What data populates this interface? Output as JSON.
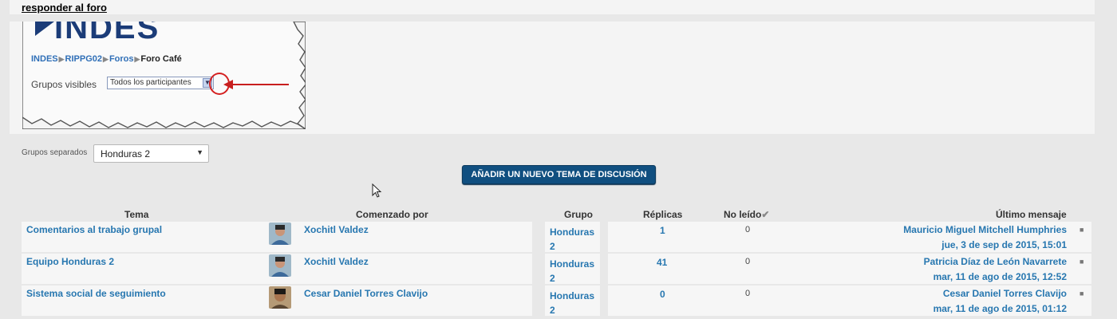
{
  "top": {
    "reply_link": "responder al foro"
  },
  "inset": {
    "logo": "INDES",
    "breadcrumb": [
      "INDES",
      "RIPPG02",
      "Foros",
      "Foro Café"
    ],
    "groups_visible_label": "Grupos visibles",
    "groups_visible_value": "Todos los participantes"
  },
  "filter": {
    "label": "Grupos separados",
    "value": "Honduras 2"
  },
  "add_button": "AÑADIR UN NUEVO TEMA DE DISCUSIÓN",
  "table": {
    "headers": {
      "topic": "Tema",
      "started_by": "Comenzado por",
      "group": "Grupo",
      "replies": "Réplicas",
      "unread": "No leído",
      "last_post": "Último mensaje"
    },
    "rows": [
      {
        "topic": "Comentarios al trabajo grupal",
        "author": "Xochitl Valdez",
        "group_line1": "Honduras",
        "group_line2": "2",
        "replies": "1",
        "unread": "0",
        "last_author": "Mauricio Miguel Mitchell Humphries",
        "last_date": "jue, 3 de sep de 2015, 15:01"
      },
      {
        "topic": "Equipo Honduras 2",
        "author": "Xochitl Valdez",
        "group_line1": "Honduras",
        "group_line2": "2",
        "replies": "41",
        "unread": "0",
        "last_author": "Patricia Díaz de León Navarrete",
        "last_date": "mar, 11 de ago de 2015, 12:52"
      },
      {
        "topic": "Sistema social de seguimiento",
        "author": "Cesar Daniel Torres Clavijo",
        "group_line1": "Honduras",
        "group_line2": "2",
        "replies": "0",
        "unread": "0",
        "last_author": "Cesar Daniel Torres Clavijo",
        "last_date": "mar, 11 de ago de 2015, 01:12"
      }
    ]
  },
  "colors": {
    "link": "#2777b0",
    "button": "#104f80",
    "annotation": "#d42020"
  }
}
